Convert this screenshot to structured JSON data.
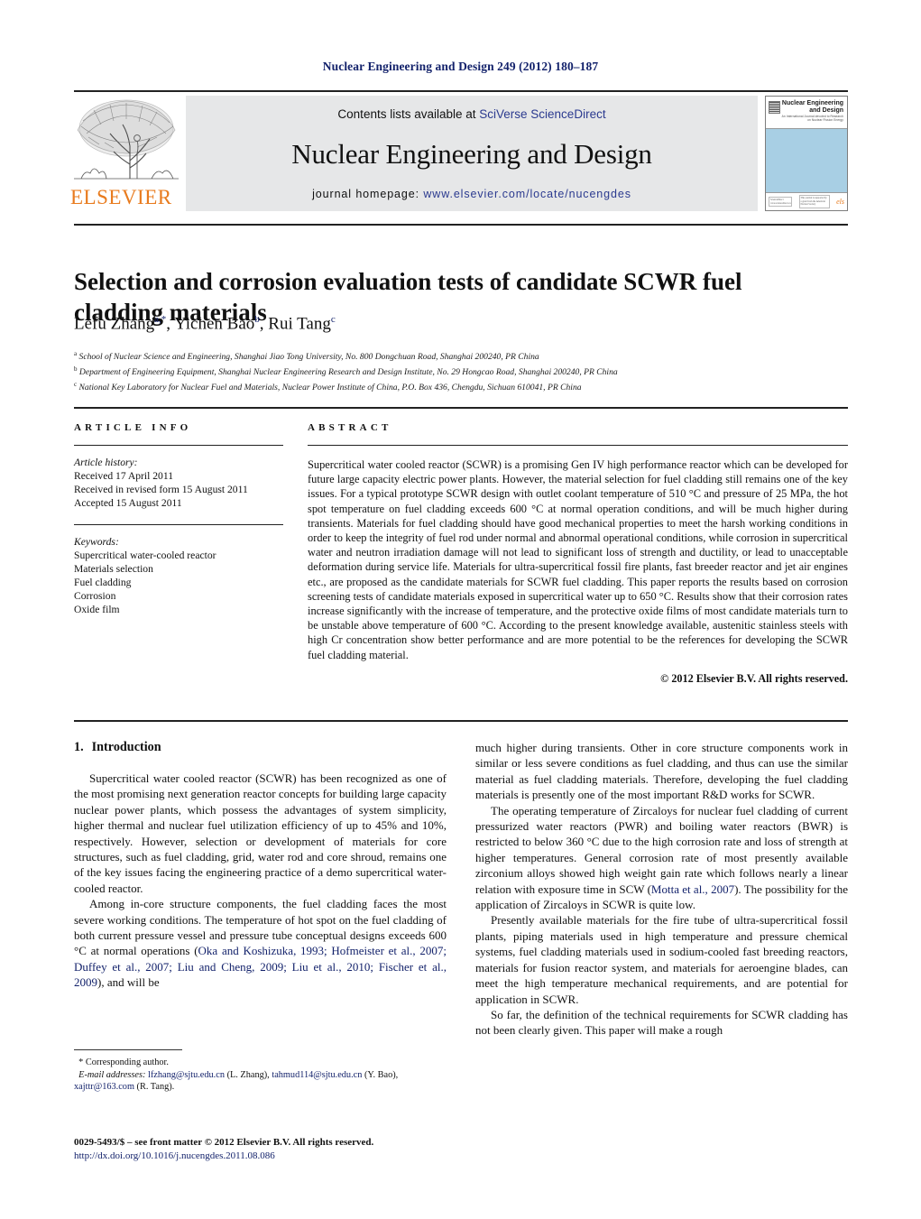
{
  "running_head": "Nuclear Engineering and Design 249 (2012) 180–187",
  "masthead": {
    "publisher_logo_text": "ELSEVIER",
    "contents_prefix": "Contents lists available at ",
    "contents_link": "SciVerse ScienceDirect",
    "journal_name": "Nuclear Engineering and Design",
    "homepage_prefix": "journal homepage: ",
    "homepage_url": "www.elsevier.com/locate/nucengdes",
    "cover": {
      "title_line1": "Nuclear Engineering",
      "title_line2": "and Design",
      "subtitle": "An International Journal devoted to Research on Nuclear Fission Energy",
      "badge_left": "ScienceDirect www.sciencedirect.com",
      "badge_center": "This journal is supported by a grant from the American Nuclear Society",
      "badge_right": "els"
    }
  },
  "article": {
    "title": "Selection and corrosion evaluation tests of candidate SCWR fuel cladding materials",
    "authors": [
      {
        "name": "Lefu Zhang",
        "marks": "a,*"
      },
      {
        "name": "Yichen Bao",
        "marks": "b"
      },
      {
        "name": "Rui Tang",
        "marks": "c"
      }
    ],
    "affiliations": [
      {
        "mark": "a",
        "text": "School of Nuclear Science and Engineering, Shanghai Jiao Tong University, No. 800 Dongchuan Road, Shanghai 200240, PR China"
      },
      {
        "mark": "b",
        "text": "Department of Engineering Equipment, Shanghai Nuclear Engineering Research and Design Institute, No. 29 Hongcao Road, Shanghai 200240, PR China"
      },
      {
        "mark": "c",
        "text": "National Key Laboratory for Nuclear Fuel and Materials, Nuclear Power Institute of China, P.O. Box 436, Chengdu, Sichuan 610041, PR China"
      }
    ]
  },
  "article_info": {
    "heading": "ARTICLE INFO",
    "history_label": "Article history:",
    "history": [
      "Received 17 April 2011",
      "Received in revised form 15 August 2011",
      "Accepted 15 August 2011"
    ],
    "keywords_label": "Keywords:",
    "keywords": [
      "Supercritical water-cooled reactor",
      "Materials selection",
      "Fuel cladding",
      "Corrosion",
      "Oxide film"
    ]
  },
  "abstract": {
    "heading": "ABSTRACT",
    "text": "Supercritical water cooled reactor (SCWR) is a promising Gen IV high performance reactor which can be developed for future large capacity electric power plants. However, the material selection for fuel cladding still remains one of the key issues. For a typical prototype SCWR design with outlet coolant temperature of 510 °C and pressure of 25 MPa, the hot spot temperature on fuel cladding exceeds 600 °C at normal operation conditions, and will be much higher during transients. Materials for fuel cladding should have good mechanical properties to meet the harsh working conditions in order to keep the integrity of fuel rod under normal and abnormal operational conditions, while corrosion in supercritical water and neutron irradiation damage will not lead to significant loss of strength and ductility, or lead to unacceptable deformation during service life. Materials for ultra-supercritical fossil fire plants, fast breeder reactor and jet air engines etc., are proposed as the candidate materials for SCWR fuel cladding. This paper reports the results based on corrosion screening tests of candidate materials exposed in supercritical water up to 650 °C. Results show that their corrosion rates increase significantly with the increase of temperature, and the protective oxide films of most candidate materials turn to be unstable above temperature of 600 °C. According to the present knowledge available, austenitic stainless steels with high Cr concentration show better performance and are more potential to be the references for developing the SCWR fuel cladding material.",
    "copyright": "© 2012 Elsevier B.V. All rights reserved."
  },
  "body": {
    "section_number": "1.",
    "section_title": "Introduction",
    "left_paragraphs": [
      "Supercritical water cooled reactor (SCWR) has been recognized as one of the most promising next generation reactor concepts for building large capacity nuclear power plants, which possess the advantages of system simplicity, higher thermal and nuclear fuel utilization efficiency of up to 45% and 10%, respectively. However, selection or development of materials for core structures, such as fuel cladding, grid, water rod and core shroud, remains one of the key issues facing the engineering practice of a demo supercritical water-cooled reactor."
    ],
    "left_para2_prefix": "Among in-core structure components, the fuel cladding faces the most severe working conditions. The temperature of hot spot on the fuel cladding of both current pressure vessel and pressure tube conceptual designs exceeds 600 °C at normal operations (",
    "left_para2_cite": "Oka and Koshizuka, 1993; Hofmeister et al., 2007; Duffey et al., 2007; Liu and Cheng, 2009; Liu et al., 2010; Fischer et al., 2009",
    "left_para2_suffix": "), and will be",
    "right_para1": "much higher during transients. Other in core structure components work in similar or less severe conditions as fuel cladding, and thus can use the similar material as fuel cladding materials. Therefore, developing the fuel cladding materials is presently one of the most important R&D works for SCWR.",
    "right_para2_prefix": "The operating temperature of Zircaloys for nuclear fuel cladding of current pressurized water reactors (PWR) and boiling water reactors (BWR) is restricted to below 360 °C due to the high corrosion rate and loss of strength at higher temperatures. General corrosion rate of most presently available zirconium alloys showed high weight gain rate which follows nearly a linear relation with exposure time in SCW (",
    "right_para2_cite": "Motta et al., 2007",
    "right_para2_suffix": "). The possibility for the application of Zircaloys in SCWR is quite low.",
    "right_para3": "Presently available materials for the fire tube of ultra-supercritical fossil plants, piping materials used in high temperature and pressure chemical systems, fuel cladding materials used in sodium-cooled fast breeding reactors, materials for fusion reactor system, and materials for aeroengine blades, can meet the high temperature mechanical requirements, and are potential for application in SCWR.",
    "right_para4": "So far, the definition of the technical requirements for SCWR cladding has not been clearly given. This paper will make a rough"
  },
  "footnotes": {
    "corresponding_mark": "*",
    "corresponding_text": "Corresponding author.",
    "email_label": "E-mail addresses:",
    "emails": [
      {
        "address": "lfzhang@sjtu.edu.cn",
        "owner": "(L. Zhang)"
      },
      {
        "address": "tahmud114@sjtu.edu.cn",
        "owner": "(Y. Bao)"
      },
      {
        "address": "xajttr@163.com",
        "owner": "(R. Tang)."
      }
    ],
    "issn_line": "0029-5493/$ – see front matter © 2012 Elsevier B.V. All rights reserved.",
    "doi_line": "http://dx.doi.org/10.1016/j.nucengdes.2011.08.086"
  },
  "colors": {
    "link_blue": "#13226b",
    "elsevier_orange": "#e87b1e",
    "band_gray": "#e6e7e8",
    "cover_blue": "#a8cfe4"
  }
}
